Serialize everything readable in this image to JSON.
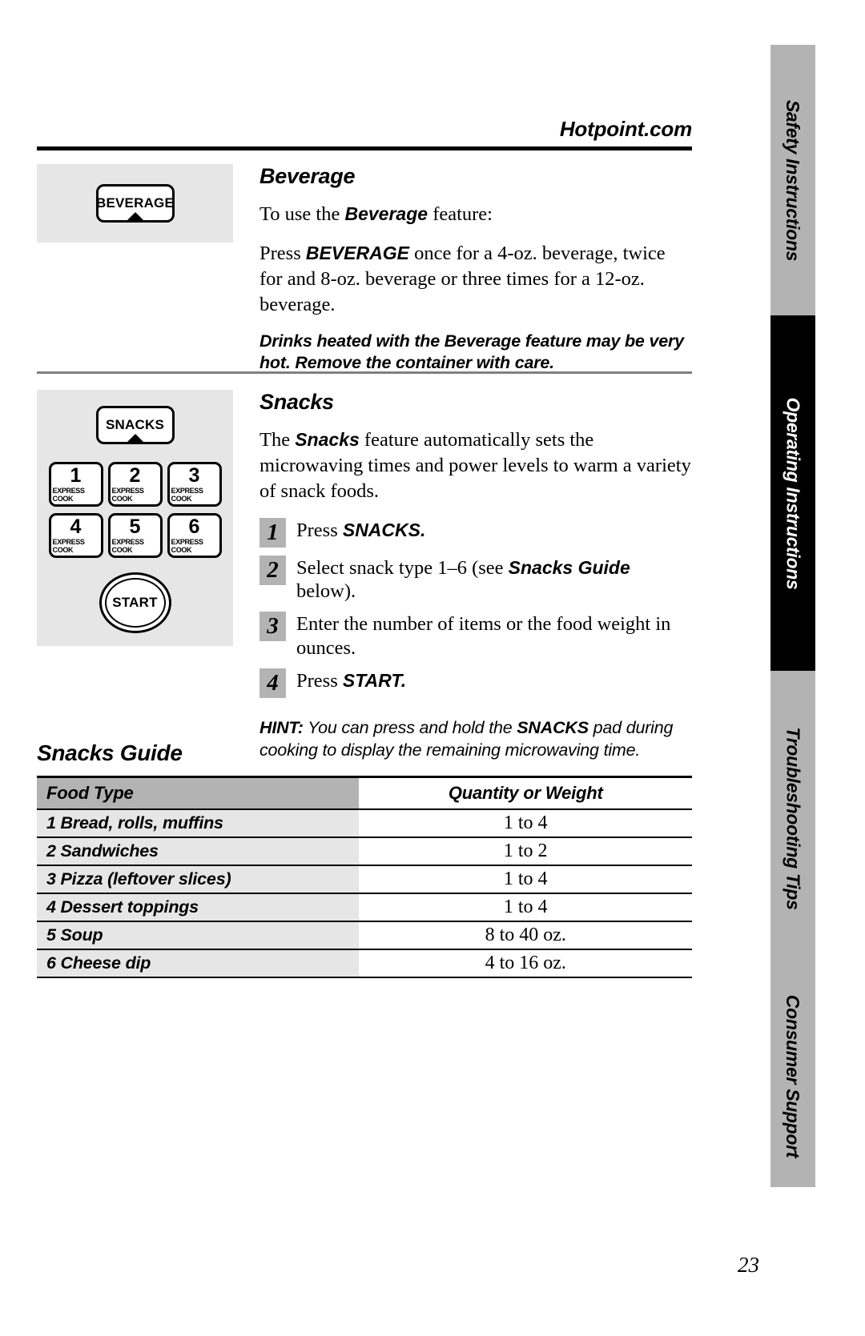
{
  "header": {
    "site": "Hotpoint.com"
  },
  "side_tabs": [
    {
      "label": "Safety Instructions",
      "state": "inactive"
    },
    {
      "label": "Operating Instructions",
      "state": "active"
    },
    {
      "label": "Troubleshooting Tips",
      "state": "inactive"
    },
    {
      "label": "Consumer Support",
      "state": "inactive"
    }
  ],
  "beverage": {
    "title": "Beverage",
    "pad_label": "BEVERAGE",
    "intro_before": "To use the ",
    "intro_bold": "Beverage",
    "intro_after": " feature:",
    "press_before": "Press ",
    "press_bold": "BEVERAGE",
    "press_after": " once for a 4-oz. beverage, twice for and 8-oz. beverage or three times for a 12-oz. beverage.",
    "warning": "Drinks heated with the Beverage feature may be very hot. Remove the container with care."
  },
  "snacks": {
    "title": "Snacks",
    "pad_label": "SNACKS",
    "intro_before": "The ",
    "intro_bold": "Snacks",
    "intro_after": " feature automatically sets the microwaving times and power levels to warm a variety of snack foods.",
    "keypad": [
      {
        "number": "1",
        "sublabel": "EXPRESS COOK"
      },
      {
        "number": "2",
        "sublabel": "EXPRESS COOK"
      },
      {
        "number": "3",
        "sublabel": "EXPRESS COOK"
      },
      {
        "number": "4",
        "sublabel": "EXPRESS COOK"
      },
      {
        "number": "5",
        "sublabel": "EXPRESS COOK"
      },
      {
        "number": "6",
        "sublabel": "EXPRESS COOK"
      }
    ],
    "start_label": "START",
    "steps": [
      {
        "num": "1",
        "before": "Press ",
        "bold": "SNACKS.",
        "after": ""
      },
      {
        "num": "2",
        "before": "Select snack type 1–6 (see ",
        "bold": "Snacks Guide",
        "after": " below)."
      },
      {
        "num": "3",
        "before": "Enter the number of items or the food weight in ounces.",
        "bold": "",
        "after": ""
      },
      {
        "num": "4",
        "before": "Press ",
        "bold": "START.",
        "after": ""
      }
    ],
    "hint_label": "HINT:",
    "hint_before": " You can press and hold the ",
    "hint_bold": "SNACKS",
    "hint_after": " pad during cooking to display the remaining microwaving time."
  },
  "guide": {
    "title": "Snacks Guide",
    "columns": [
      "Food Type",
      "Quantity or Weight"
    ],
    "rows": [
      {
        "food": "1 Bread, rolls, muffins",
        "qty": "1 to 4"
      },
      {
        "food": "2 Sandwiches",
        "qty": "1 to 2"
      },
      {
        "food": "3 Pizza (leftover slices)",
        "qty": "1 to 4"
      },
      {
        "food": "4 Dessert toppings",
        "qty": "1 to 4"
      },
      {
        "food": "5 Soup",
        "qty": "8 to 40 oz."
      },
      {
        "food": "6 Cheese dip",
        "qty": "4 to 16 oz."
      }
    ]
  },
  "page_number": "23"
}
